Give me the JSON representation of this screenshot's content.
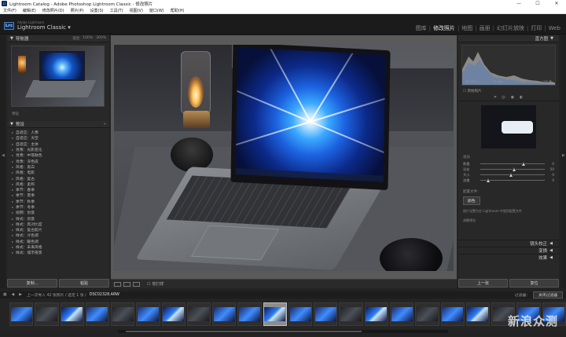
{
  "window": {
    "title": "Lightroom Catalog - Adobe Photoshop Lightroom Classic - 修改照片",
    "controls": [
      "—",
      "☐",
      "✕"
    ]
  },
  "menu": [
    "文件(F)",
    "编辑(E)",
    "修改照片(D)",
    "照片(P)",
    "设置(S)",
    "工具(T)",
    "视图(V)",
    "窗口(W)",
    "帮助(H)"
  ],
  "identity": {
    "badge": "Lrc",
    "brand_small": "Adobe Lightroom",
    "brand": "Lightroom Classic",
    "dropdown": "▾"
  },
  "modules": [
    "图库",
    "修改照片",
    "地图",
    "画册",
    "幻灯片放映",
    "打印",
    "Web"
  ],
  "left_panel": {
    "navigator_title": "导航器",
    "navigator_zoom": [
      "适合",
      "100%",
      "300%"
    ],
    "collapsed_hint": "预设",
    "presets_title": "预设",
    "presets": [
      "自适应：人像",
      "自适应：天空",
      "自适应：主体",
      "肖像：光影变化",
      "肖像：中等肤色",
      "肖像：深色皮",
      "风格：黑白",
      "风格：电影",
      "风格：复古",
      "风格：柔和",
      "季节：春季",
      "季节：夏季",
      "季节：秋季",
      "季节：冬季",
      "视频：创意",
      "样式：创意",
      "样式：高对比度",
      "样式：复古胶片",
      "样式：冷色调",
      "样式：暖色调",
      "样式：未来风格",
      "样式：城市夜景"
    ],
    "btn_copy": "复制...",
    "btn_paste": "粘贴"
  },
  "main_toolbar": {
    "label": "软打样"
  },
  "right_panel": {
    "histogram_title": "直方图",
    "histogram_vals": [
      "ISO 400",
      "23 mm",
      "f/2.8",
      "1/60 秒"
    ],
    "original_label": "原始照片",
    "tool_icons": [
      "crop-icon",
      "spot-icon",
      "redeye-icon",
      "mask-icon"
    ],
    "adjust_header": "滤光",
    "sliders": [
      {
        "label": "数量",
        "value": "0",
        "pos": 0.65
      },
      {
        "label": "羽化",
        "value": "50",
        "pos": 0.5
      },
      {
        "label": "大小",
        "value": "0",
        "pos": 0.45
      },
      {
        "label": "流量",
        "value": "0",
        "pos": 0.1
      }
    ],
    "profile_label": "配置文件：",
    "profile_value": "颜色",
    "desc": "照片设置为在 Lightroom 中使用配置文件",
    "preview_label": "调整预览",
    "sections": [
      "镜头校正",
      "变换",
      "效果"
    ],
    "btn_prev": "上一张",
    "btn_reset": "复位"
  },
  "filmstrip": {
    "nav_text": "上一次导入  42 张照片 / 选定 1 张 /",
    "filename": "DSC02328.ARW",
    "filter_label": "过滤器：",
    "filter_value": "关闭过滤器",
    "thumbs": 22,
    "selected_index": 10
  },
  "watermark": "新浪众测"
}
